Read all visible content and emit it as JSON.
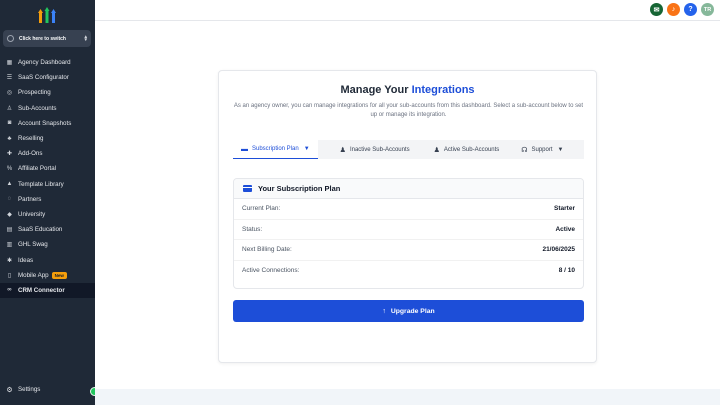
{
  "sidebar": {
    "switcher_label": "Click here to switch",
    "items": [
      {
        "label": "Agency Dashboard",
        "icon": "grid-icon"
      },
      {
        "label": "SaaS Configurator",
        "icon": "sliders-icon"
      },
      {
        "label": "Prospecting",
        "icon": "compass-icon"
      },
      {
        "label": "Sub-Accounts",
        "icon": "user-icon"
      },
      {
        "label": "Account Snapshots",
        "icon": "camera-icon"
      },
      {
        "label": "Reselling",
        "icon": "sitemap-icon"
      },
      {
        "label": "Add-Ons",
        "icon": "puzzle-icon"
      },
      {
        "label": "Affiliate Portal",
        "icon": "percent-icon"
      },
      {
        "label": "Template Library",
        "icon": "building-icon"
      },
      {
        "label": "Partners",
        "icon": "handshake-icon"
      },
      {
        "label": "University",
        "icon": "graduation-cap-icon"
      },
      {
        "label": "SaaS Education",
        "icon": "book-icon"
      },
      {
        "label": "GHL Swag",
        "icon": "gift-icon"
      },
      {
        "label": "Ideas",
        "icon": "lightbulb-icon"
      },
      {
        "label": "Mobile App",
        "icon": "mobile-icon",
        "badge": "New"
      },
      {
        "label": "CRM Connector",
        "icon": "link-icon",
        "active": true
      }
    ],
    "settings_label": "Settings"
  },
  "topbar": {
    "avatar_initials": "TR",
    "colors": {
      "megaphone": "#166534",
      "bell": "#f97316",
      "help": "#2563eb",
      "avatar": "#86b89a"
    }
  },
  "integrations": {
    "title_prefix": "Manage Your ",
    "title_accent": "Integrations",
    "description": "As an agency owner, you can manage integrations for all your sub-accounts from this dashboard. Select a sub-account below to set up or manage its integration.",
    "tabs": [
      {
        "label": "Subscription Plan",
        "icon": "credit-card-icon",
        "active": true,
        "caret": true
      },
      {
        "label": "Inactive Sub-Accounts",
        "icon": "user-slash-icon"
      },
      {
        "label": "Active Sub-Accounts",
        "icon": "user-check-icon"
      },
      {
        "label": "Support",
        "icon": "headset-icon",
        "caret": true
      }
    ],
    "subscription": {
      "heading": "Your Subscription Plan",
      "rows": [
        {
          "label": "Current Plan:",
          "value": "Starter"
        },
        {
          "label": "Status:",
          "value": "Active"
        },
        {
          "label": "Next Billing Date:",
          "value": "21/06/2025"
        },
        {
          "label": "Active Connections:",
          "value": "8 / 10"
        }
      ]
    },
    "upgrade_label": "Upgrade Plan"
  },
  "colors": {
    "accent": "#1d4ed8",
    "sidebar": "#1f2937"
  }
}
